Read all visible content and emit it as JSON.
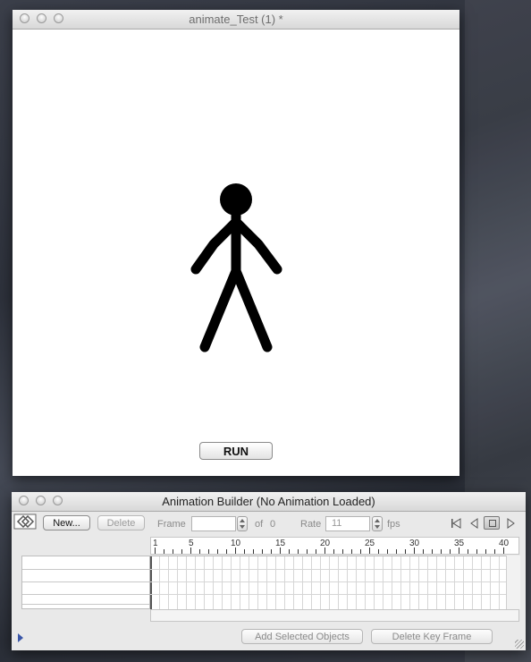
{
  "animate_window": {
    "title": "animate_Test (1) *",
    "run_label": "RUN"
  },
  "builder": {
    "title": "Animation Builder (No Animation Loaded)",
    "new_label": "New...",
    "delete_label": "Delete",
    "frame_label": "Frame",
    "frame_value": "",
    "of_label": "of",
    "frame_total": "0",
    "rate_label": "Rate",
    "rate_value": "11",
    "fps_label": "fps",
    "ruler_labels": [
      "1",
      "5",
      "10",
      "15",
      "20",
      "25",
      "30",
      "35",
      "40"
    ],
    "add_selected_label": "Add Selected Objects",
    "delete_keyframe_label": "Delete Key Frame"
  },
  "icons": [
    "close-light-icon",
    "minimize-light-icon",
    "zoom-light-icon",
    "onion-skin-icon",
    "first-frame-icon",
    "prev-frame-icon",
    "stop-icon",
    "next-frame-icon",
    "disclosure-triangle-icon",
    "resize-grip-icon"
  ]
}
